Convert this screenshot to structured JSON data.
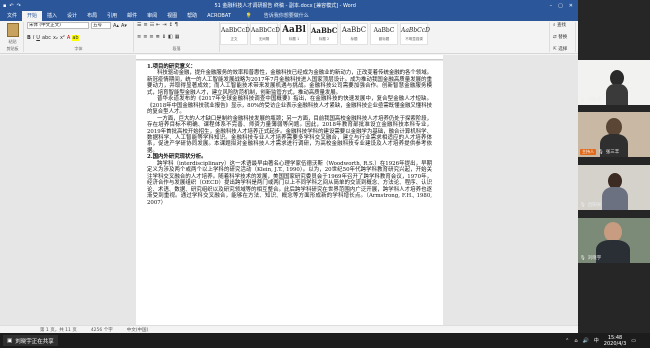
{
  "word": {
    "title": "51 金融科技人才调研报告 终稿 - 副本.docx [兼容模式] - Word",
    "quick_access": [
      "save-icon",
      "undo-icon",
      "redo-icon"
    ],
    "tabs": [
      "文件",
      "开始",
      "插入",
      "设计",
      "布局",
      "引用",
      "邮件",
      "审阅",
      "视图",
      "帮助",
      "ACROBAT"
    ],
    "tell_me": "告诉我你想要做什么",
    "ribbon": {
      "paste": "粘贴",
      "font_name": "宋体 (中文正文)",
      "font_size": "五号",
      "groups": [
        "剪贴板",
        "字体",
        "段落",
        "样式",
        "编辑"
      ],
      "styles": [
        {
          "preview": "AaBbCcDd",
          "label": "正文"
        },
        {
          "preview": "AaBbCcDd",
          "label": "无间隔"
        },
        {
          "preview": "AaBl",
          "label": "标题 1"
        },
        {
          "preview": "AaBbC",
          "label": "标题 2"
        },
        {
          "preview": "AaBbC",
          "label": "标题"
        },
        {
          "preview": "AaBbC",
          "label": "副标题"
        },
        {
          "preview": "AaBbCcD",
          "label": "不明显强调"
        }
      ],
      "editing": [
        "查找",
        "替换",
        "选择"
      ]
    },
    "document": {
      "section1": "1.项目的研究意义：",
      "p1": "科技驱动金融，提升金融服务的效率和普惠性，金融科技已经成为金融业的新动力，正改变着传统金融的各个领域。新冠疫情期间，统一的人工智能发展战略为2017年7月金融科技进入国家顶层设计。成为推动我国金融高质量发展的重要动力，并取得显著成效；而人工智能技术带来发展机遇与挑战。金融科技公司需要加强合作。创新智慧金融服务模式，培育智能型金融人才，建立风险防范机制，创新监管方式，推动高质量发展。",
      "p2": "普华永道发布的《2017年全球金融科技调查中国概要》指出，在金融科技的快速发展中，复合型金融人才短缺。《2018年中国金融科技就业报告》显示，80%的受访企业表示金融科技人才紧缺，金融科技企业亟需既懂金融又懂科技的复合型人才。",
      "p3": "一方面，巨大的人才缺口是制约金融科技发展的瓶颈；另一方面，目前我国高校金融科技人才培养仍处于探索阶段，存在培养目标不明确、课程体系不完善、师资力量薄弱等问题。因此，2018年教育部批准设立金融科技本科专业，2019年首批高校开始招生，金融科技人才培养正式起步。金融科技学科的建设需要以金融学为基础，融合计算机科学、数据科学、人工智能等学科知识。金融科技专业人才培养需要多学科交叉融合，建立与行业需求相适应的人才培养体系，促进产学研协同发展。本课题拟对金融科技人才需求进行调研，为高校金融科技专业建设及人才培养提供参考依据。",
      "section2": "2.国内外研究现状分析。",
      "p4": "跨学科（interdisciplinary）这一术语最早由著名心理学家伍德沃斯（Woodworth, R.S.）在1926年提出，早期定义为涉及两个或两个以上学科的研究活动（Klein, J.T., 1990）。以为，20世纪50年代跨学科教育研究兴起，开始关注学科交叉融合的人才培养。随着科学技术的发展，美国国家研究委员会于1969年召开了跨学科教育会议，1970年，经济合作与发展组织（OECD）提出跨学科是两门或两门以上不同学科之间从简单的交流到概念、方法论、程序、认识论、术语、数据、研究组织以及研究领域等的相互整合。此后跨学科研究在世界范围内广泛开展，跨学科人才培养也逐渐受到重视。通过学科交叉融合，能够在方法、知识、概念等方面形成新的学科增长点。（Armstrong, F.H., 1980, 2007）"
    },
    "status": {
      "page": "第 1 页，共 11 页",
      "words": "4256 个字",
      "lang": "中文(中国)"
    }
  },
  "meeting": {
    "participants": [
      {
        "name": "刘晓寒",
        "badge": ""
      },
      {
        "name": "张三丰",
        "badge": "主持人"
      },
      {
        "name": "吕阳光",
        "badge": ""
      },
      {
        "name": "刘晓宇",
        "badge": ""
      }
    ],
    "share_label": "刘晓宇正在共享",
    "colors": {
      "host_badge": "#e06a1a",
      "word_brand": "#2b579a"
    }
  },
  "taskbar": {
    "time": "15:48",
    "date": "2020/4/3",
    "tray_icons": [
      "up-arrow-icon",
      "network-icon",
      "volume-icon",
      "ime-icon",
      "notification-icon"
    ],
    "ime": "中"
  }
}
